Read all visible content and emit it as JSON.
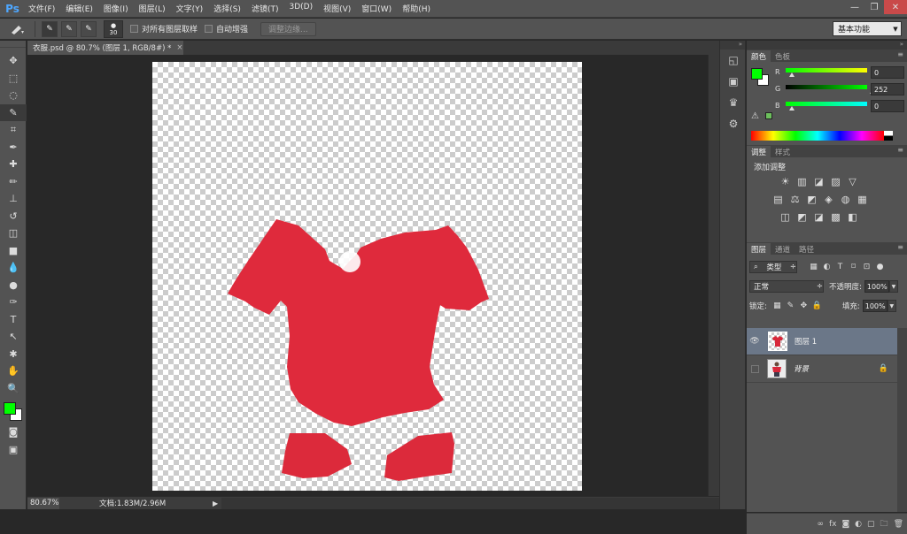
{
  "app": {
    "logo": "Ps"
  },
  "menu": [
    "文件(F)",
    "编辑(E)",
    "图像(I)",
    "图层(L)",
    "文字(Y)",
    "选择(S)",
    "滤镜(T)",
    "3D(D)",
    "视图(V)",
    "窗口(W)",
    "帮助(H)"
  ],
  "window_controls": [
    "—",
    "❐",
    "✕"
  ],
  "options": {
    "brush_size": "30",
    "sample_all_layers": "对所有图层取样",
    "auto_enhance": "自动增强",
    "refine_edge": "调整边缘...",
    "workspace": "基本功能"
  },
  "document": {
    "tab_title": "衣服.psd @ 80.7% (图层 1, RGB/8#) *",
    "close": "×",
    "zoom": "80.67%",
    "doc_info": "文档:1.83M/2.96M",
    "status_arrow": "▶"
  },
  "tools": [
    "move-tool",
    "marquee-tool",
    "lasso-tool",
    "quick-selection-tool",
    "crop-tool",
    "eyedropper-tool",
    "spot-healing-tool",
    "brush-tool",
    "clone-stamp-tool",
    "history-brush-tool",
    "eraser-tool",
    "gradient-tool",
    "blur-tool",
    "dodge-tool",
    "pen-tool",
    "type-tool",
    "path-selection-tool",
    "shape-tool",
    "hand-tool",
    "zoom-tool"
  ],
  "tool_glyphs": [
    "✥",
    "⬚",
    "◌",
    "✎",
    "⌗",
    "✒",
    "✚",
    "✏",
    "⊥",
    "↺",
    "◫",
    "■",
    "💧",
    "●",
    "✑",
    "T",
    "↖",
    "✱",
    "✋",
    "🔍"
  ],
  "colors": {
    "foreground": "#00FF00",
    "background": "#FFFFFF",
    "swatch": "#6CBF5C"
  },
  "color_panel": {
    "tabs": [
      "颜色",
      "色板"
    ],
    "menu": "≡",
    "warning_glyph": "⚠",
    "channels": [
      {
        "label": "R",
        "value": "0"
      },
      {
        "label": "G",
        "value": "252"
      },
      {
        "label": "B",
        "value": "0"
      }
    ]
  },
  "adjustments_panel": {
    "tabs": [
      "调整",
      "样式"
    ],
    "menu": "≡",
    "title": "添加调整",
    "row1": [
      "☀",
      "▥",
      "◪",
      "▨",
      "▽"
    ],
    "row2": [
      "▤",
      "⚖",
      "◩",
      "◈",
      "◍",
      "▦"
    ],
    "row3": [
      "◫",
      "◩",
      "◪",
      "▩",
      "◧"
    ]
  },
  "layers_panel": {
    "tabs": [
      "图层",
      "通道",
      "路径"
    ],
    "menu": "≡",
    "filter_kind": "类型",
    "filter_icons": [
      "▦",
      "◐",
      "T",
      "⌑",
      "⊡",
      "●"
    ],
    "blend_mode": "正常",
    "opacity_label": "不透明度:",
    "opacity_value": "100%",
    "lock_label": "锁定:",
    "lock_icons": [
      "▦",
      "✎",
      "✥",
      "🔒"
    ],
    "fill_label": "填充:",
    "fill_value": "100%",
    "layers": [
      {
        "name": "图层 1",
        "visible_glyph": "👁"
      },
      {
        "name": "背景",
        "visible_glyph": "",
        "lock_glyph": "🔒"
      }
    ],
    "footer_icons": [
      "∞",
      "fx",
      "◙",
      "◐",
      "▢",
      "🗀",
      "🗑"
    ]
  },
  "icon_strip": [
    "◱",
    "▣",
    "♛",
    "⚙"
  ],
  "panel_collapse": "»"
}
